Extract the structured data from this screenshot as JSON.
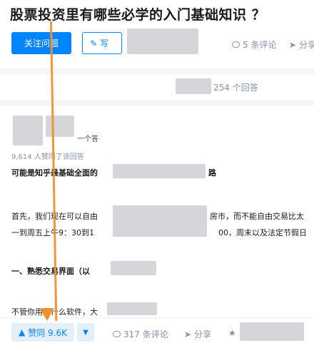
{
  "question": {
    "title": "股票投资里有哪些必学的入门基础知识 ？",
    "follow_label": "关注问题",
    "write_label": "写",
    "comments": "5 条评论",
    "share": "分享"
  },
  "answers_count": "254 个回答",
  "answer": {
    "author_note": "一个答",
    "votes_line": "9,614 人赞同了该回答",
    "p1": "可能是知乎最基础全面的",
    "p1_tail": "路",
    "p2a": "首先，我们现在可以自由",
    "p2b": "房市，而不能自由交易比太",
    "p3a": "一到周五上午9：30到1",
    "p3b": "00，周末以及法定节假日",
    "h1": "一、熟悉交易界面（以",
    "p4": "不管你用的什么软件，大"
  },
  "footer": {
    "vote_label": "赞同 9.6K",
    "comments": "317 条评论",
    "share": "分享"
  },
  "colors": {
    "accent": "#0084ff",
    "annotation": "#f09030"
  }
}
